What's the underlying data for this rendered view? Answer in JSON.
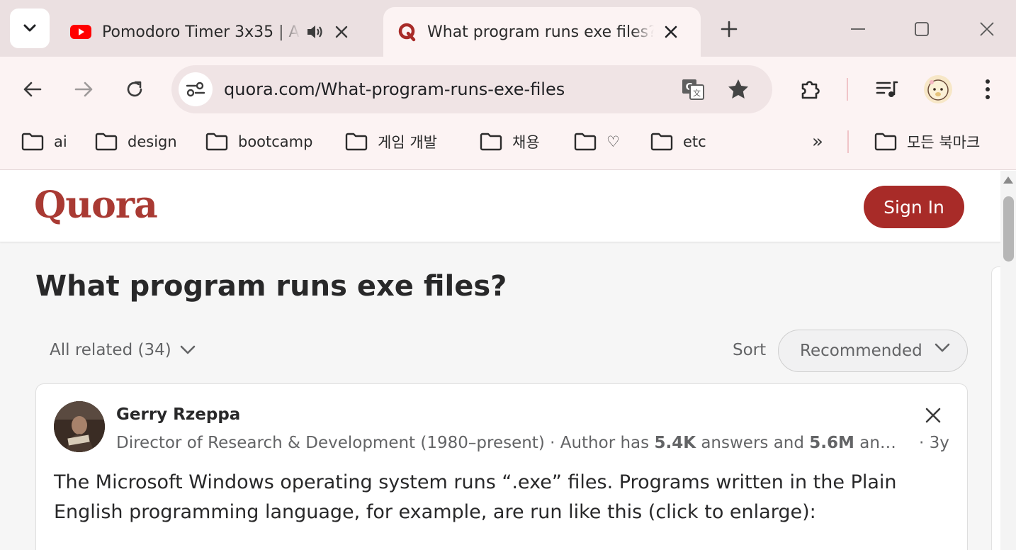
{
  "tabs": [
    {
      "title": "Pomodoro Timer 3x35 | A",
      "icon": "youtube-icon",
      "audio": true
    },
    {
      "title": "What program runs exe files?",
      "icon": "quora-icon",
      "active": true
    }
  ],
  "toolbar": {
    "url": "quora.com/What-program-runs-exe-files"
  },
  "bookmarks": {
    "items": [
      "ai",
      "design",
      "bootcamp",
      "게임 개발",
      "채용",
      "♡",
      "etc"
    ],
    "more": "»",
    "all_bookmarks": "모든 북마크"
  },
  "quora": {
    "logo": "Quora",
    "sign_in": "Sign In",
    "question": "What program runs exe files?",
    "all_related": "All related (34)",
    "sort_label": "Sort",
    "sort_value": "Recommended",
    "answer": {
      "author": "Gerry Rzeppa",
      "cred_prefix": "Director of Research & Development (1980–present) · Author has ",
      "answers_count": "5.4K",
      "cred_mid": " answers and ",
      "views_count": "5.6M",
      "cred_suffix": " an…",
      "age": "· 3y",
      "text": "The Microsoft Windows operating system runs “.exe” files. Programs written in the Plain English programming language, for example, are run like this (click to enlarge):"
    }
  },
  "colors": {
    "quora_red": "#a82b28",
    "tabstrip": "#ebe0e1",
    "toolbar": "#fcf3f3"
  }
}
